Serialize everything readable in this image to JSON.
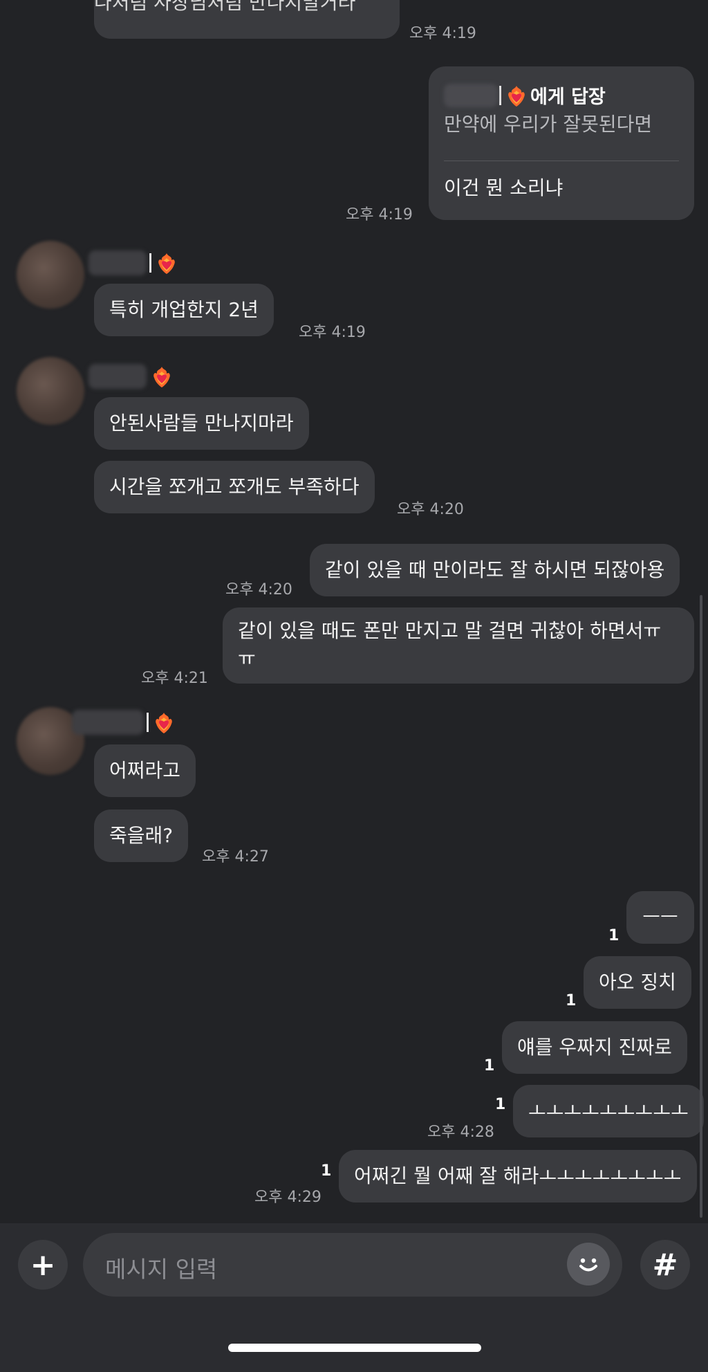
{
  "messages": {
    "m0_text": "나처럼 사장님처럼 만나지말거라",
    "m0_time": "오후 4:19",
    "reply": {
      "header_suffix": "에게 답장",
      "quote": "만약에 우리가 잘못된다면",
      "text": "이건 뭔 소리냐",
      "time": "오후 4:19"
    },
    "m2_text": "특히 개업한지 2년",
    "m2_time": "오후 4:19",
    "m3_text": "안된사람들 만나지마라",
    "m4_text": "시간을 쪼개고 쪼개도 부족하다",
    "m4_time": "오후 4:20",
    "m5_text": "같이 있을 때 만이라도 잘 하시면 되잖아용",
    "m5_time": "오후 4:20",
    "m6_line1": "같이 있을 때도 폰만 만지고 말 걸면 귀찮아 하면서ㅠ",
    "m6_line2": "ㅠ",
    "m6_time": "오후 4:21",
    "m7_text": "어쩌라고",
    "m8_text": "죽을래?",
    "m8_time": "오후 4:27",
    "m9_text": "ㅡㅡ",
    "m9_unread": "1",
    "m10_text": "아오 징치",
    "m10_unread": "1",
    "m11_text": "얘를 우짜지 진짜로",
    "m11_unread": "1",
    "m12_text": "ㅗㅗㅗㅗㅗㅗㅗㅗㅗ",
    "m12_unread": "1",
    "m12_time": "오후 4:28",
    "m13_text": "어쩌긴 뭘 어째 잘 해라ㅗㅗㅗㅗㅗㅗㅗㅗ",
    "m13_unread": "1",
    "m13_time": "오후 4:29"
  },
  "input": {
    "placeholder": "메시지 입력",
    "plus_label": "+",
    "hash_label": "#"
  },
  "colors": {
    "background": "#222326",
    "bubble": "#3a3b3f",
    "input_bar": "#2b2c30"
  }
}
